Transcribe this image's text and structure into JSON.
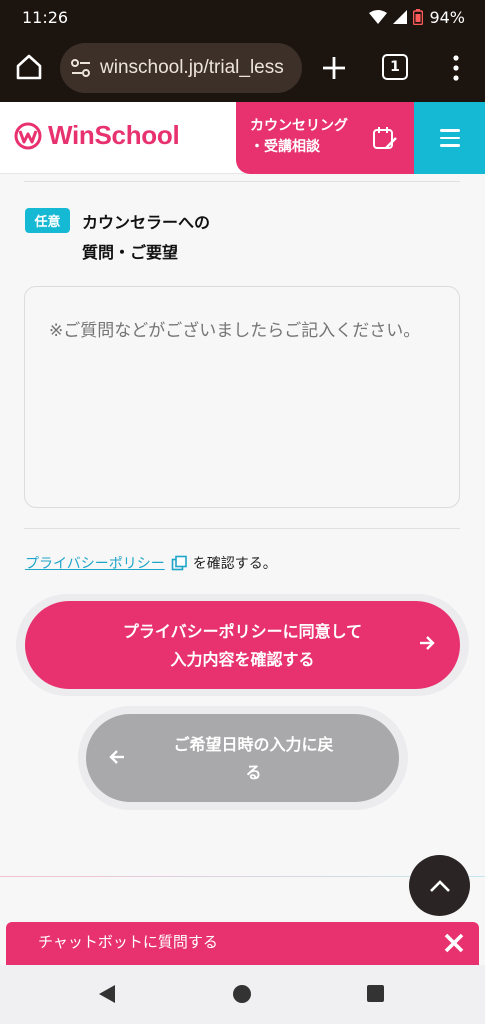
{
  "status": {
    "time": "11:26",
    "battery": "94%"
  },
  "browser": {
    "url": "winschool.jp/trial_less",
    "tab_count": "1"
  },
  "header": {
    "logo_text": "WinSchool",
    "counsel_line1": "カウンセリング",
    "counsel_line2": "・受講相談"
  },
  "form": {
    "badge": "任意",
    "label_line1": "カウンセラーへの",
    "label_line2": "質問・ご要望",
    "placeholder": "※ご質問などがございましたらご記入ください。"
  },
  "privacy": {
    "link_text": "プライバシーポリシー",
    "rest_text": "を確認する。"
  },
  "buttons": {
    "confirm_line1": "プライバシーポリシーに同意して",
    "confirm_line2": "入力内容を確認する",
    "back_line1": "ご希望日時の入力に戻",
    "back_line2": "る"
  },
  "chatbot": {
    "label": "チャットボットに質問する"
  },
  "colors": {
    "brand_pink": "#e8326f",
    "accent_cyan": "#15b9d4",
    "back_gray": "#a9a9ab"
  }
}
